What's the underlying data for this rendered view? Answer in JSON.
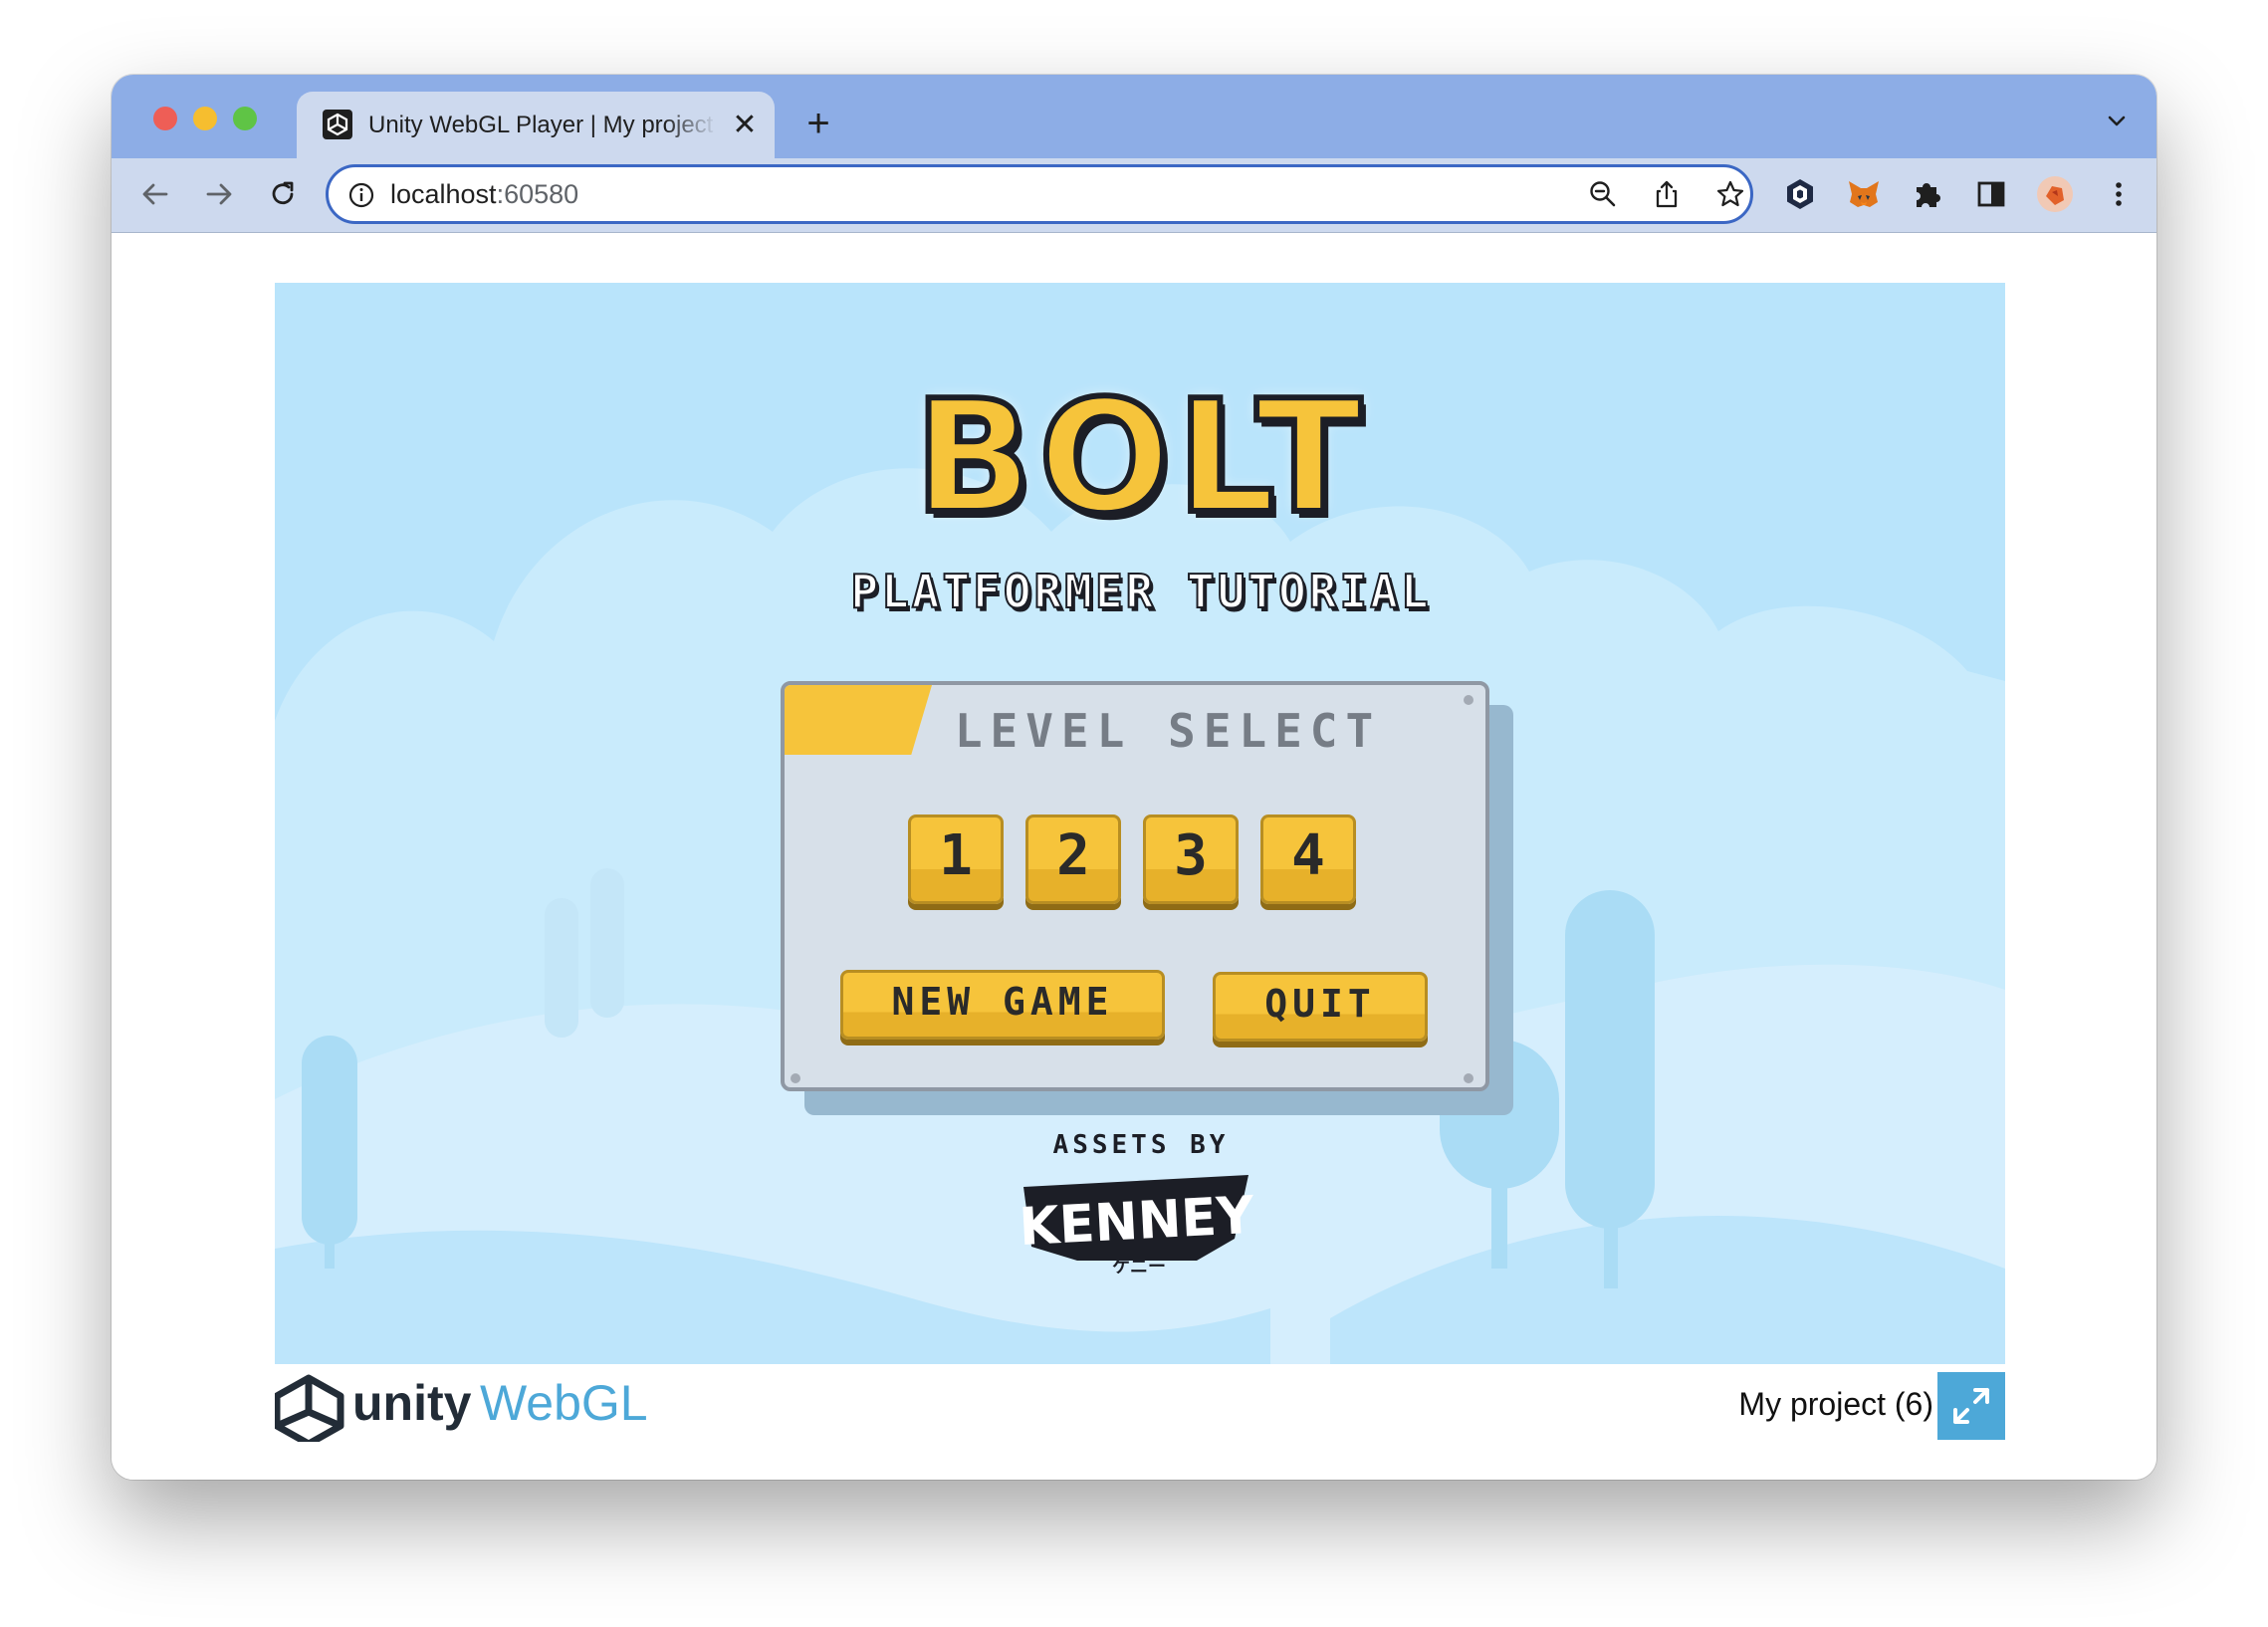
{
  "browser": {
    "tab": {
      "title": "Unity WebGL Player | My project (6)",
      "favicon": "unity-icon"
    },
    "new_tab_label": "+",
    "tab_close_label": "✕",
    "url_host": "localhost",
    "url_port": ":60580",
    "toolbar_icons": [
      "back-arrow-icon",
      "forward-arrow-icon",
      "reload-icon",
      "info-icon",
      "zoom-out-icon",
      "share-icon",
      "bookmark-star-icon"
    ],
    "extension_icons": [
      "crypto-wallet-icon",
      "metamask-fox-icon",
      "puzzle-extensions-icon",
      "side-panel-icon",
      "profile-avatar",
      "kebab-menu-icon"
    ]
  },
  "game": {
    "logo_title": "BOLT",
    "logo_subtitle": "PLATFORMER TUTORIAL",
    "panel_title": "LEVEL SELECT",
    "level_buttons": [
      "1",
      "2",
      "3",
      "4"
    ],
    "new_game_label": "NEW GAME",
    "quit_label": "QUIT",
    "assets_label": "ASSETS BY",
    "assets_logo": "KENNEY",
    "assets_logo_sub": "ケニー"
  },
  "footer": {
    "unity_word": "unity",
    "webgl_word": "WebGL",
    "project_name": "My project (6)"
  },
  "colors": {
    "tabbar": "#8dade6",
    "toolbar": "#cdd9ee",
    "sky": "#b9e4fb",
    "accent_yellow": "#f6c43b",
    "panel": "#d7e0e9",
    "fullscreen_button": "#4da8d8",
    "webgl_blue": "#4da8d8"
  }
}
